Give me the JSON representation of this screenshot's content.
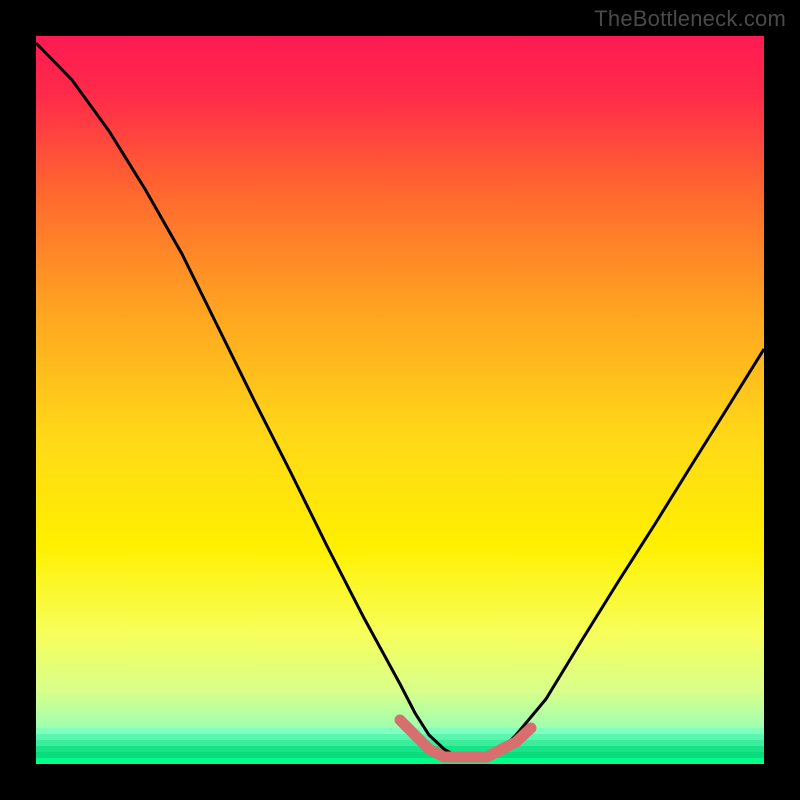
{
  "watermark": "TheBottleneck.com",
  "chart_data": {
    "type": "line",
    "title": "",
    "xlabel": "",
    "ylabel": "",
    "xlim": [
      0,
      100
    ],
    "ylim": [
      0,
      100
    ],
    "series": [
      {
        "name": "bottleneck-curve",
        "x": [
          0,
          5,
          10,
          15,
          20,
          25,
          30,
          35,
          40,
          45,
          50,
          52,
          54,
          56,
          58,
          60,
          62,
          64,
          66,
          70,
          75,
          80,
          85,
          90,
          95,
          100
        ],
        "values": [
          99,
          94,
          87,
          79,
          70,
          60,
          50,
          40,
          30,
          20,
          11,
          7,
          4,
          2,
          1,
          1,
          1,
          2,
          4,
          9,
          17,
          25,
          33,
          41,
          49,
          57
        ]
      },
      {
        "name": "optimal-zone-highlight",
        "x": [
          50,
          52,
          54,
          56,
          58,
          60,
          62,
          64,
          66,
          68
        ],
        "values": [
          6,
          4,
          2,
          1,
          1,
          1,
          1,
          2,
          3,
          5
        ]
      }
    ],
    "gradient": {
      "top_color": "#ff1a52",
      "mid_color": "#fff000",
      "bottom_color": "#2de06a",
      "bottom_band_color": "#00ff88"
    },
    "highlight_color": "#d86e6e",
    "curve_color": "#000000"
  }
}
